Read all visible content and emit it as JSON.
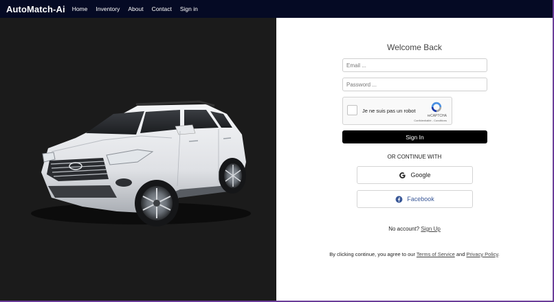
{
  "navbar": {
    "brand": "AutoMatch-Ai",
    "links": [
      "Home",
      "Inventory",
      "About",
      "Contact",
      "Sign in"
    ],
    "background": "#050a24"
  },
  "hero": {
    "background": "#1b1b1b",
    "image": "white-suv"
  },
  "login": {
    "title": "Welcome Back",
    "email_placeholder": "Email ...",
    "password_placeholder": "Password ...",
    "recaptcha": {
      "label": "Je ne suis pas un robot",
      "brand": "reCAPTCHA",
      "terms": "Confidentialité - Conditions"
    },
    "signin_label": "Sign In",
    "or_label": "OR CONTINUE WITH",
    "google_label": "Google",
    "facebook_label": "Facebook",
    "facebook_color": "#3b5998",
    "no_account_text": "No account?",
    "signup_label": "Sign Up",
    "legal": {
      "prefix": "By clicking continue, you agree to our",
      "terms": "Terms of Service",
      "and": "and",
      "privacy": "Privacy Policy",
      "suffix": "."
    }
  }
}
